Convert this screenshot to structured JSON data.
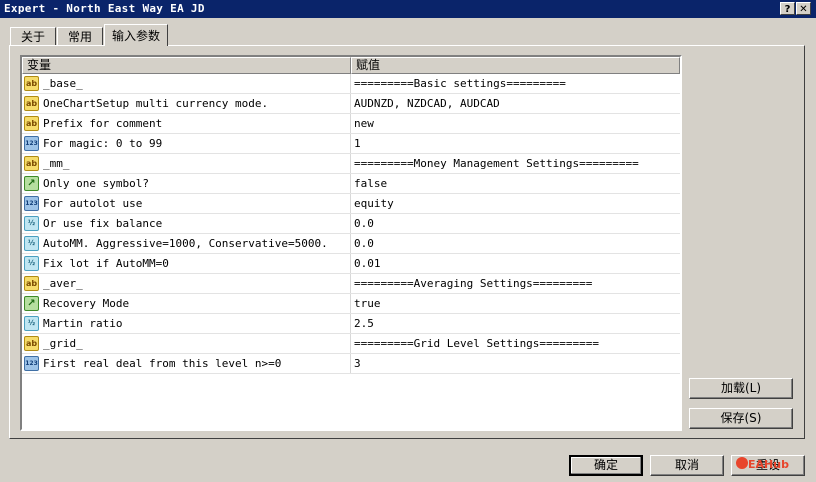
{
  "window": {
    "title": "Expert - North East Way EA JD",
    "help_label": "?",
    "close_label": "✕"
  },
  "tabs": [
    {
      "label": "关于"
    },
    {
      "label": "常用"
    },
    {
      "label": "输入参数"
    }
  ],
  "table": {
    "columns": [
      "变量",
      "赋值"
    ],
    "rows": [
      {
        "type": "ab-icon",
        "name": "_base_",
        "value": "=========Basic settings========="
      },
      {
        "type": "ab-icon",
        "name": "OneChartSetup multi currency mode.",
        "value": "AUDNZD, NZDCAD, AUDCAD"
      },
      {
        "type": "ab-icon",
        "name": "Prefix for comment",
        "value": "new"
      },
      {
        "type": "int-icon",
        "name": "For magic: 0 to 99",
        "value": "1"
      },
      {
        "type": "ab-icon",
        "name": "_mm_",
        "value": "=========Money Management Settings========="
      },
      {
        "type": "bool-icon",
        "name": "Only one symbol?",
        "value": "false"
      },
      {
        "type": "int-icon",
        "name": "For autolot use",
        "value": "equity"
      },
      {
        "type": "double-icon",
        "name": "Or use fix balance",
        "value": "0.0"
      },
      {
        "type": "double-icon",
        "name": "AutoMM. Aggressive=1000, Conservative=5000.",
        "value": "0.0"
      },
      {
        "type": "double-icon",
        "name": "Fix lot if AutoMM=0",
        "value": "0.01"
      },
      {
        "type": "ab-icon",
        "name": "_aver_",
        "value": "=========Averaging Settings========="
      },
      {
        "type": "bool-icon",
        "name": "Recovery Mode",
        "value": "true"
      },
      {
        "type": "double-icon",
        "name": "Martin ratio",
        "value": "2.5"
      },
      {
        "type": "ab-icon",
        "name": "_grid_",
        "value": "=========Grid Level Settings========="
      },
      {
        "type": "int-icon",
        "name": "First real deal from this level n>=0",
        "value": "3"
      }
    ]
  },
  "icons": {
    "ab-icon": "ab",
    "int-icon": "123",
    "bool-icon": "↗",
    "double-icon": "½"
  },
  "side_buttons": {
    "load": "加载(L)",
    "save": "保存(S)"
  },
  "footer_buttons": {
    "ok": "确定",
    "cancel": "取消",
    "reset": "重设"
  },
  "watermark": "EAHub"
}
